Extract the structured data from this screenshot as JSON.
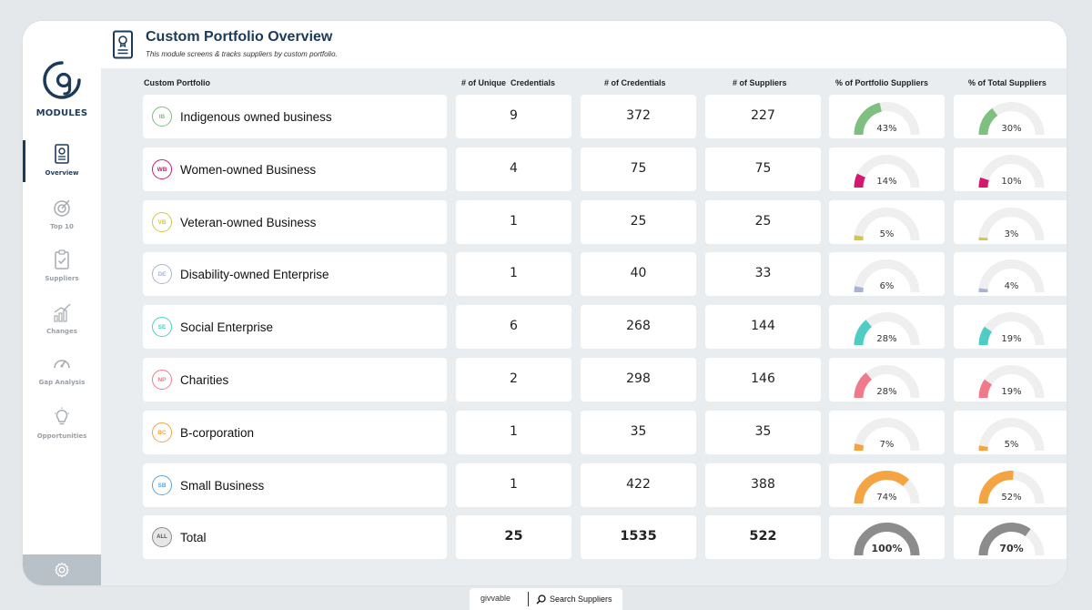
{
  "sidebar": {
    "modules_label": "MODULES",
    "items": [
      {
        "label": "Overview",
        "icon": "certificate-icon",
        "active": true
      },
      {
        "label": "Top 10",
        "icon": "target-icon",
        "active": false
      },
      {
        "label": "Suppliers",
        "icon": "clipboard-check-icon",
        "active": false
      },
      {
        "label": "Changes",
        "icon": "trend-chart-icon",
        "active": false
      },
      {
        "label": "Gap Analysis",
        "icon": "gauge-icon",
        "active": false
      },
      {
        "label": "Opportunities",
        "icon": "lightbulb-icon",
        "active": false
      }
    ],
    "footer_icon": "gear-icon"
  },
  "header": {
    "title": "Custom Portfolio Overview",
    "subtitle": "This module screens & tracks suppliers by custom portfolio.",
    "icon": "certificate-icon"
  },
  "columns": [
    "Custom Portfolio",
    "# of Unique  Credentials",
    "# of Credentials",
    "# of Suppliers",
    "% of Portfolio Suppliers",
    "% of Total Suppliers"
  ],
  "rows": [
    {
      "badge": "IB",
      "name": "Indigenous owned business",
      "color": "#7fbf7f",
      "unique": "9",
      "credentials": "372",
      "suppliers": "227",
      "pct_portfolio_label": "43%",
      "pct_portfolio": 0.43,
      "pct_total_label": "30%",
      "pct_total": 0.3
    },
    {
      "badge": "WB",
      "name": "Women-owned Business",
      "color": "#d6176f",
      "unique": "4",
      "credentials": "75",
      "suppliers": "75",
      "pct_portfolio_label": "14%",
      "pct_portfolio": 0.14,
      "pct_total_label": "10%",
      "pct_total": 0.1
    },
    {
      "badge": "VB",
      "name": "Veteran-owned Business",
      "color": "#d4c64a",
      "unique": "1",
      "credentials": "25",
      "suppliers": "25",
      "pct_portfolio_label": "5%",
      "pct_portfolio": 0.05,
      "pct_total_label": "3%",
      "pct_total": 0.03
    },
    {
      "badge": "DE",
      "name": "Disability-owned Enterprise",
      "color": "#a9b3d6",
      "unique": "1",
      "credentials": "40",
      "suppliers": "33",
      "pct_portfolio_label": "6%",
      "pct_portfolio": 0.06,
      "pct_total_label": "4%",
      "pct_total": 0.04
    },
    {
      "badge": "SE",
      "name": "Social Enterprise",
      "color": "#4ecdc4",
      "unique": "6",
      "credentials": "268",
      "suppliers": "144",
      "pct_portfolio_label": "28%",
      "pct_portfolio": 0.28,
      "pct_total_label": "19%",
      "pct_total": 0.19
    },
    {
      "badge": "NP",
      "name": "Charities",
      "color": "#f07a89",
      "unique": "2",
      "credentials": "298",
      "suppliers": "146",
      "pct_portfolio_label": "28%",
      "pct_portfolio": 0.28,
      "pct_total_label": "19%",
      "pct_total": 0.19
    },
    {
      "badge": "BC",
      "name": "B-corporation",
      "color": "#f5a443",
      "unique": "1",
      "credentials": "35",
      "suppliers": "35",
      "pct_portfolio_label": "7%",
      "pct_portfolio": 0.07,
      "pct_total_label": "5%",
      "pct_total": 0.05
    },
    {
      "badge": "SB",
      "name": "Small Business",
      "color": "#f5a443",
      "badge_color": "#5aa3e0",
      "unique": "1",
      "credentials": "422",
      "suppliers": "388",
      "pct_portfolio_label": "74%",
      "pct_portfolio": 0.74,
      "pct_total_label": "52%",
      "pct_total": 0.52
    },
    {
      "badge": "ALL",
      "name": "Total",
      "color": "#8c8c8c",
      "unique": "25",
      "credentials": "1535",
      "suppliers": "522",
      "pct_portfolio_label": "100%",
      "pct_portfolio": 1.0,
      "pct_total_label": "70%",
      "pct_total": 0.7,
      "total": true
    }
  ],
  "bottom_bar": {
    "brand": "givvable",
    "search_label": "Search Suppliers"
  }
}
